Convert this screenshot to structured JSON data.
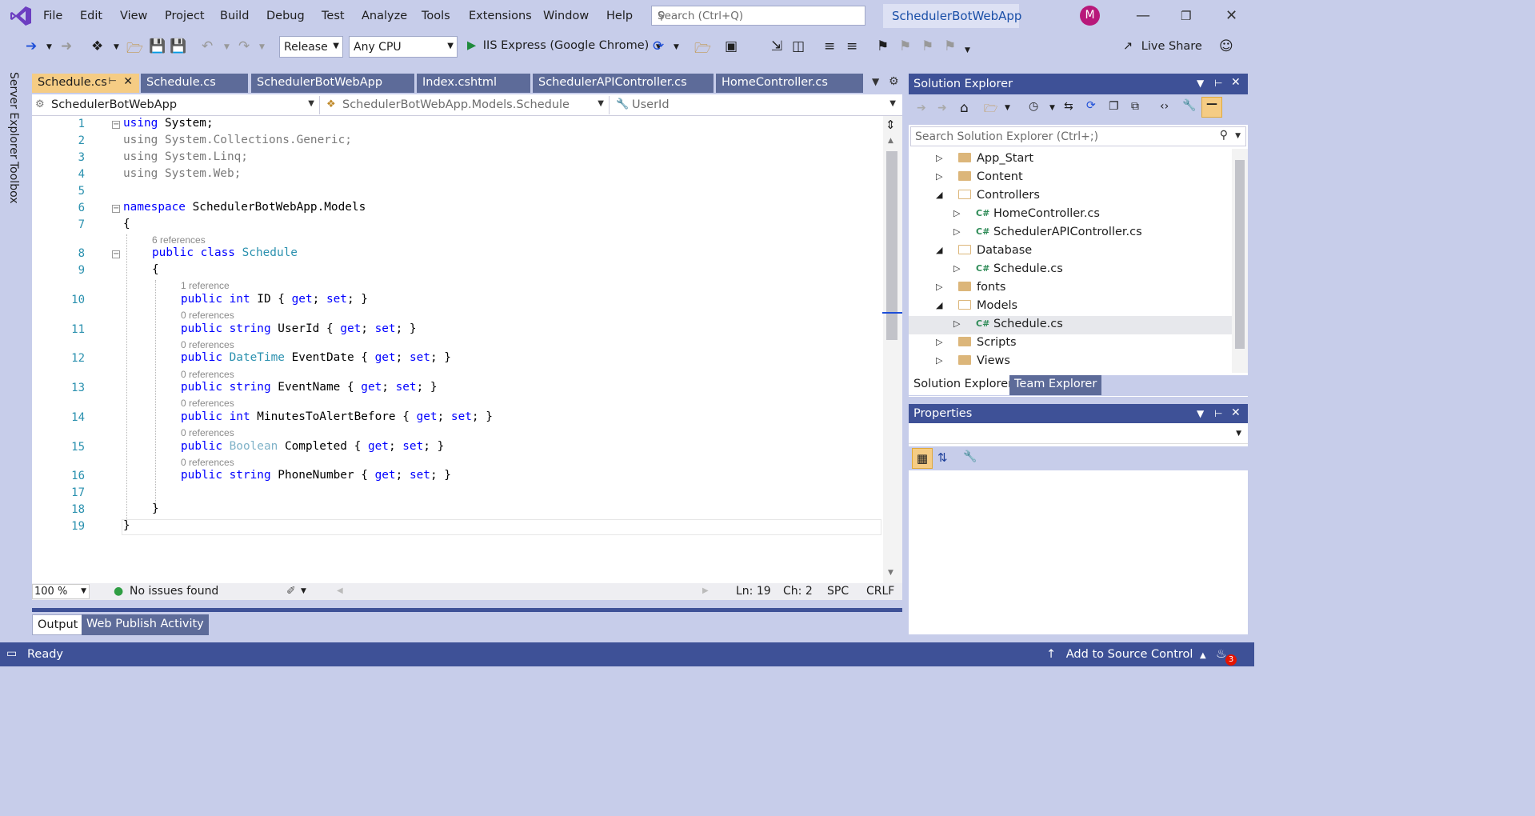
{
  "app": {
    "logo_icon": "visual-studio-logo-icon",
    "menu": [
      "File",
      "Edit",
      "View",
      "Project",
      "Build",
      "Debug",
      "Test",
      "Analyze",
      "Tools",
      "Extensions",
      "Window",
      "Help"
    ],
    "search_placeholder": "Search (Ctrl+Q)",
    "solution_name": "SchedulerBotWebApp",
    "avatar_initial": "M",
    "accent": "#3e5197"
  },
  "toolbar": {
    "configuration": "Release",
    "platform": "Any CPU",
    "run_target": "IIS Express (Google Chrome)",
    "live_share": "Live Share"
  },
  "side_strip": [
    "Server Explorer",
    "Toolbox"
  ],
  "tabs": [
    "Schedule.cs",
    "Schedule.cs",
    "SchedulerBotWebApp",
    "Index.cshtml",
    "SchedulerAPIController.cs",
    "HomeController.cs"
  ],
  "navbar": {
    "project": "SchedulerBotWebApp",
    "type": "SchedulerBotWebApp.Models.Schedule",
    "member": "UserId"
  },
  "code": {
    "line_numbers": [
      "1",
      "2",
      "3",
      "4",
      "5",
      "6",
      "7",
      "8",
      "9",
      "10",
      "11",
      "12",
      "13",
      "14",
      "15",
      "16",
      "17",
      "18",
      "19"
    ],
    "lines": {
      "l1_kw": "using",
      "l1_rest": " System;",
      "l2": "using System.Collections.Generic;",
      "l3": "using System.Linq;",
      "l4": "using System.Web;",
      "l6_kw": "namespace",
      "l6_rest": " SchedulerBotWebApp.Models",
      "l7": "{",
      "l8_ref": "6 references",
      "l8_kw": "public class",
      "l8_ty": "Schedule",
      "l9": "{",
      "l10_ref": "1 reference",
      "l10_a": "public int",
      "l10_b": " ID { ",
      "l10_c": "get",
      "l10_d": "; ",
      "l10_e": "set",
      "l10_f": "; }",
      "l11_ref": "0 references",
      "l11_a": "public string",
      "l11_b": " UserId { ",
      "l11_c": "get",
      "l11_d": "; ",
      "l11_e": "set",
      "l11_f": "; }",
      "l12_ref": "0 references",
      "l12_a": "public",
      "l12_ty": " DateTime",
      "l12_b": " EventDate { ",
      "l12_c": "get",
      "l12_d": "; ",
      "l12_e": "set",
      "l12_f": "; }",
      "l13_ref": "0 references",
      "l13_a": "public string",
      "l13_b": " EventName { ",
      "l13_c": "get",
      "l13_d": "; ",
      "l13_e": "set",
      "l13_f": "; }",
      "l14_ref": "0 references",
      "l14_a": "public int",
      "l14_b": " MinutesToAlertBefore { ",
      "l14_c": "get",
      "l14_d": "; ",
      "l14_e": "set",
      "l14_f": "; }",
      "l15_ref": "0 references",
      "l15_a": "public",
      "l15_ty": " Boolean",
      "l15_b": " Completed { ",
      "l15_c": "get",
      "l15_d": "; ",
      "l15_e": "set",
      "l15_f": "; }",
      "l16_ref": "0 references",
      "l16_a": "public string",
      "l16_b": " PhoneNumber { ",
      "l16_c": "get",
      "l16_d": "; ",
      "l16_e": "set",
      "l16_f": "; }",
      "l18": "}",
      "l19": "}"
    }
  },
  "editor_status": {
    "zoom": "100 %",
    "issues": "No issues found",
    "ln": "Ln: 19",
    "ch": "Ch: 2",
    "spc": "SPC",
    "crlf": "CRLF"
  },
  "output_tabs": [
    "Output",
    "Web Publish Activity"
  ],
  "solution_explorer": {
    "title": "Solution Explorer",
    "search_placeholder": "Search Solution Explorer (Ctrl+;)",
    "items": [
      {
        "label": "App_Start",
        "kind": "folder",
        "expanded": false
      },
      {
        "label": "Content",
        "kind": "folder",
        "expanded": false
      },
      {
        "label": "Controllers",
        "kind": "folder",
        "expanded": true
      },
      {
        "label": "HomeController.cs",
        "kind": "cs",
        "expanded": false
      },
      {
        "label": "SchedulerAPIController.cs",
        "kind": "cs",
        "expanded": false
      },
      {
        "label": "Database",
        "kind": "folder",
        "expanded": true
      },
      {
        "label": "Schedule.cs",
        "kind": "cs",
        "expanded": false
      },
      {
        "label": "fonts",
        "kind": "folder",
        "expanded": false
      },
      {
        "label": "Models",
        "kind": "folder",
        "expanded": true
      },
      {
        "label": "Schedule.cs",
        "kind": "cs",
        "expanded": false,
        "selected": true
      },
      {
        "label": "Scripts",
        "kind": "folder",
        "expanded": false
      },
      {
        "label": "Views",
        "kind": "folder",
        "expanded": false
      }
    ],
    "bottom_tabs": [
      "Solution Explorer",
      "Team Explorer"
    ]
  },
  "properties": {
    "title": "Properties"
  },
  "statusbar": {
    "ready": "Ready",
    "source_control": "Add to Source Control",
    "notification_count": "3"
  }
}
